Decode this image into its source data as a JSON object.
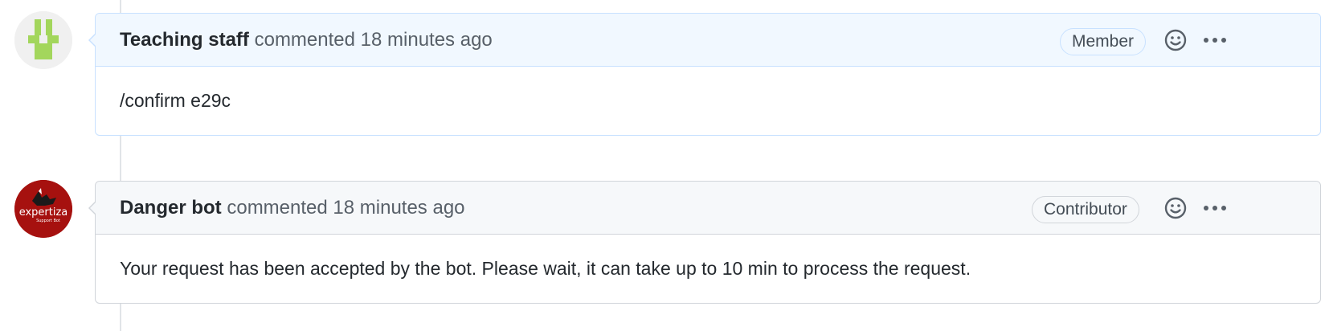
{
  "comments": [
    {
      "author": "Teaching staff",
      "action": "commented",
      "time": "18 minutes ago",
      "badge": "Member",
      "body": "/confirm e29c",
      "avatar": "identicon-green"
    },
    {
      "author": "Danger bot",
      "action": "commented",
      "time": "18 minutes ago",
      "badge": "Contributor",
      "body": "Your request has been accepted by the bot. Please wait, it can take up to 10 min to process the request.",
      "avatar": "expertiza-logo",
      "avatar_text": "expertiza",
      "avatar_subtext": "Support Bot"
    }
  ],
  "icons": {
    "reaction": "smiley-icon",
    "more": "kebab-horizontal-icon"
  },
  "colors": {
    "member_header_bg": "#f1f8ff",
    "member_border": "#c8e1ff",
    "contributor_header_bg": "#f6f8fa",
    "identicon_green": "#a3d65c",
    "bot_avatar_red": "#a6110f"
  }
}
